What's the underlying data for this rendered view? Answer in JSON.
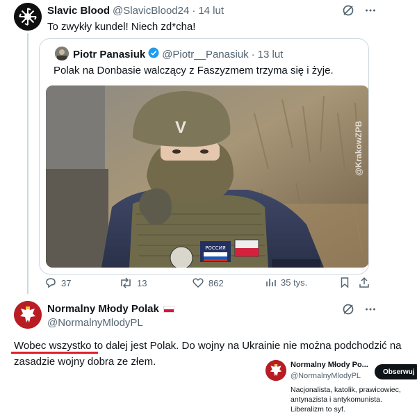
{
  "tweet1": {
    "author_name": "Slavic Blood",
    "handle": "@SlavicBlood24",
    "separator": "·",
    "date": "14 lut",
    "text": "To zwykły kundel! Niech zd*cha!"
  },
  "quote": {
    "author_name": "Piotr Panasiuk",
    "handle": "@Piotr__Panasiuk",
    "separator": "·",
    "date": "13 lut",
    "text": "Polak na Donbasie walczący z Faszyzmem trzyma się i żyje.",
    "media_watermark": "@KrakowZPB",
    "helmet_letter": "V",
    "patch_text": "РОССИЯ"
  },
  "actions": {
    "replies": "37",
    "retweets": "13",
    "likes": "862",
    "views": "35 tys."
  },
  "tweet2": {
    "author_name": "Normalny Młody Polak",
    "handle": "@NormalnyMlodyPL",
    "text": "Wobec wszystko to dalej jest Polak. Do wojny na Ukrainie nie można podchodzić na zasadzie wojny dobra ze złem."
  },
  "hover_card": {
    "name": "Normalny Młody Po...",
    "handle": "@NormalnyMlodyPL",
    "follow_label": "Obserwuj",
    "bio": "Nacjonalista, katolik, prawicowiec, antynazista i antykomunista. Liberalizm to syf."
  },
  "colors": {
    "verified": "#1d9bf0",
    "underline": "#e0202a",
    "muted": "#536471",
    "border": "#cfd9de"
  }
}
